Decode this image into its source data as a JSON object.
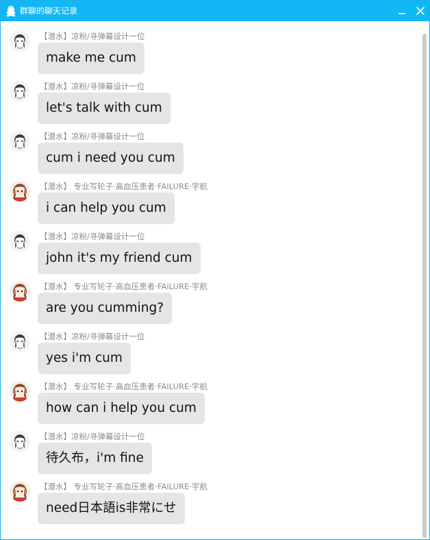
{
  "window": {
    "title": "群聊的聊天记录",
    "accent_color": "#12b7f5",
    "title_icon": "qq-penguin-icon",
    "controls": {
      "minimize": "minimize-icon",
      "close": "close-icon"
    }
  },
  "messages": [
    {
      "sender": "【潜水】凉粉/寻弹幕设计一位",
      "text": "make me cum",
      "avatar": "user-avatar-a"
    },
    {
      "sender": "【潜水】凉粉/寻弹幕设计一位",
      "text": "let's talk with cum",
      "avatar": "user-avatar-a"
    },
    {
      "sender": "【潜水】凉粉/寻弹幕设计一位",
      "text": "cum i need you cum",
      "avatar": "user-avatar-a"
    },
    {
      "sender": "【潜水】 专业写轮子·高血压患者·FAILURE·宇航",
      "text": "i can help you cum",
      "avatar": "user-avatar-b"
    },
    {
      "sender": "【潜水】凉粉/寻弹幕设计一位",
      "text": "john it's my friend cum",
      "avatar": "user-avatar-a"
    },
    {
      "sender": "【潜水】 专业写轮子·高血压患者·FAILURE·宇航",
      "text": "are you cumming?",
      "avatar": "user-avatar-b"
    },
    {
      "sender": "【潜水】凉粉/寻弹幕设计一位",
      "text": "yes i'm cum",
      "avatar": "user-avatar-a"
    },
    {
      "sender": "【潜水】 专业写轮子·高血压患者·FAILURE·宇航",
      "text": "how can i help you cum",
      "avatar": "user-avatar-b"
    },
    {
      "sender": "【潜水】凉粉/寻弹幕设计一位",
      "text": "待久布，i'm fine",
      "avatar": "user-avatar-a"
    },
    {
      "sender": "【潜水】 专业写轮子·高血压患者·FAILURE·宇航",
      "text": "need日本語is非常にせ",
      "avatar": "user-avatar-b"
    }
  ]
}
